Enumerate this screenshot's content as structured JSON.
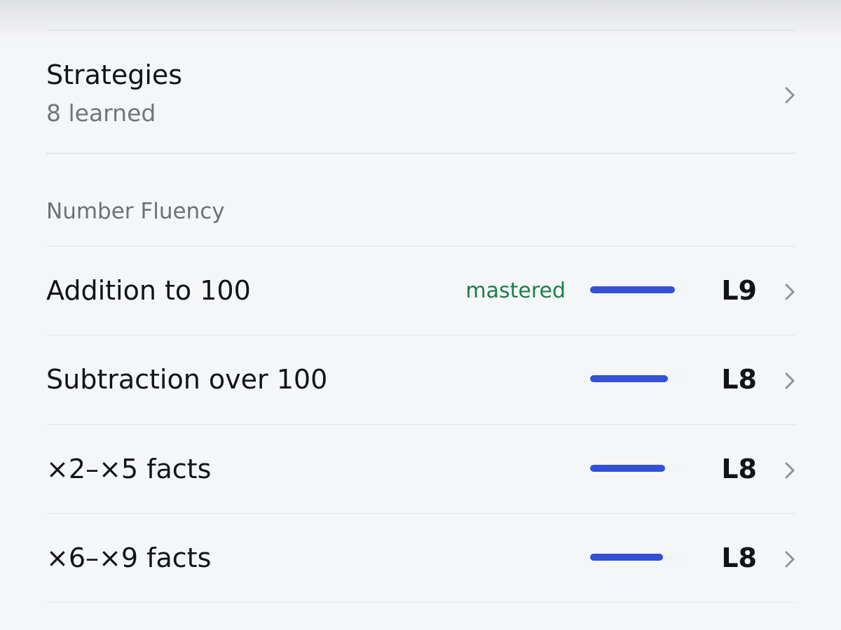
{
  "strategies": {
    "title": "Strategies",
    "subtitle": "8 learned",
    "chevron_icon": "chevron-right-icon"
  },
  "number_fluency": {
    "header": "Number Fluency",
    "items": [
      {
        "label": "Addition to 100",
        "badge": "mastered",
        "progress": 0.85,
        "level": "L9"
      },
      {
        "label": "Subtraction over 100",
        "badge": "",
        "progress": 0.78,
        "level": "L8"
      },
      {
        "label": "×2–×5 facts",
        "badge": "",
        "progress": 0.75,
        "level": "L8"
      },
      {
        "label": "×6–×9 facts",
        "badge": "",
        "progress": 0.73,
        "level": "L8"
      }
    ]
  },
  "colors": {
    "accent": "#3350d6",
    "mastered": "#1c7f4d",
    "background": "#f5f6f8",
    "secondary_text": "#70757d",
    "chevron": "#8e9299"
  }
}
